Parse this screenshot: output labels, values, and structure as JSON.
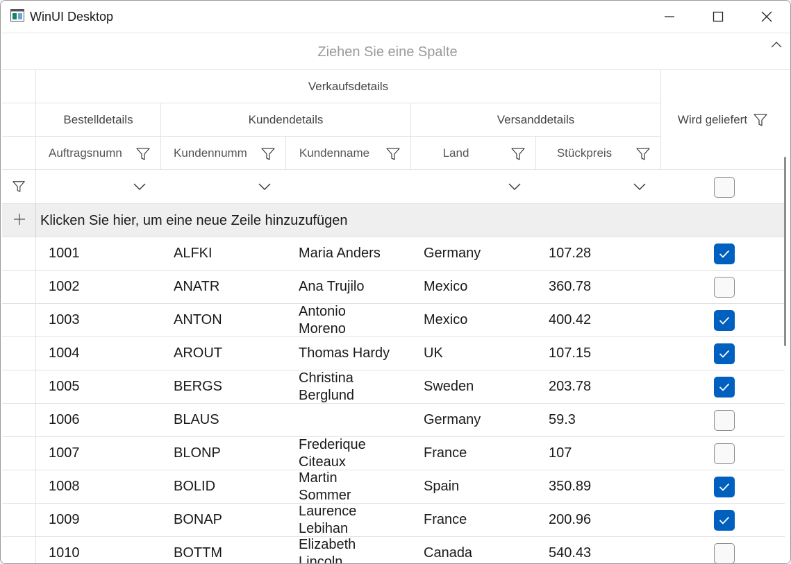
{
  "window": {
    "title": "WinUI Desktop",
    "accent": "#0060c0"
  },
  "group_area": {
    "placeholder": "Ziehen Sie eine Spalte"
  },
  "stacked_headers": {
    "top": "Verkaufsdetails",
    "groups": [
      "Bestelldetails",
      "Kundendetails",
      "Versanddetails"
    ]
  },
  "columns": [
    "Auftragsnumn",
    "Kundennumm",
    "Kundenname",
    "Land",
    "Stückpreis",
    "Wird geliefert"
  ],
  "add_row": {
    "label": "Klicken Sie hier, um eine neue Zeile hinzuzufügen"
  },
  "rows": [
    {
      "order": "1001",
      "customer_id": "ALFKI",
      "name_1": "Maria Anders",
      "name_2": "",
      "country": "Germany",
      "price": "107.28",
      "delivered": true
    },
    {
      "order": "1002",
      "customer_id": "ANATR",
      "name_1": "Ana Trujilo",
      "name_2": "",
      "country": "Mexico",
      "price": "360.78",
      "delivered": false
    },
    {
      "order": "1003",
      "customer_id": "ANTON",
      "name_1": "Antonio",
      "name_2": "Moreno",
      "country": "Mexico",
      "price": "400.42",
      "delivered": true
    },
    {
      "order": "1004",
      "customer_id": "AROUT",
      "name_1": "Thomas Hardy",
      "name_2": "",
      "country": "UK",
      "price": "107.15",
      "delivered": true
    },
    {
      "order": "1005",
      "customer_id": "BERGS",
      "name_1": "Christina",
      "name_2": "Berglund",
      "country": "Sweden",
      "price": "203.78",
      "delivered": true
    },
    {
      "order": "1006",
      "customer_id": "BLAUS",
      "name_1": "",
      "name_2": "",
      "country": "Germany",
      "price": "59.3",
      "delivered": false
    },
    {
      "order": "1007",
      "customer_id": "BLONP",
      "name_1": "Frederique",
      "name_2": "Citeaux",
      "country": "France",
      "price": "107",
      "delivered": false
    },
    {
      "order": "1008",
      "customer_id": "BOLID",
      "name_1": "Martin",
      "name_2": "Sommer",
      "country": "Spain",
      "price": "350.89",
      "delivered": true
    },
    {
      "order": "1009",
      "customer_id": "BONAP",
      "name_1": "Laurence",
      "name_2": "Lebihan",
      "country": "France",
      "price": "200.96",
      "delivered": true
    },
    {
      "order": "1010",
      "customer_id": "BOTTM",
      "name_1": "Elizabeth",
      "name_2": "Lincoln",
      "country": "Canada",
      "price": "540.43",
      "delivered": false
    }
  ]
}
